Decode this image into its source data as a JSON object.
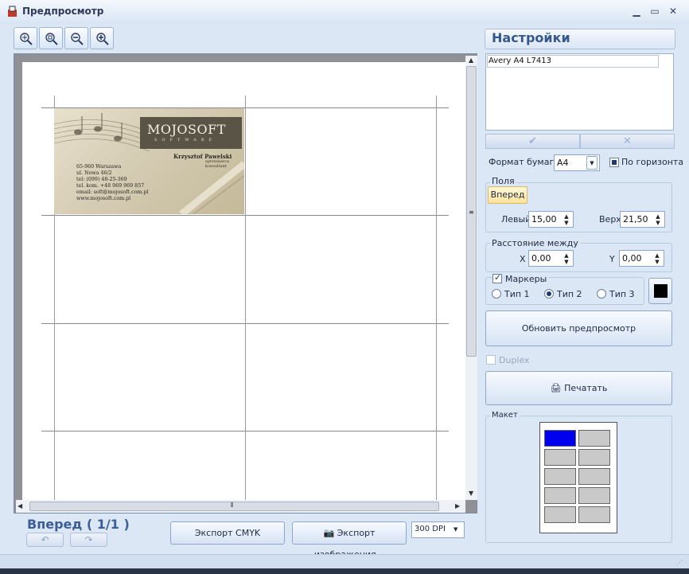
{
  "window": {
    "title": "Предпросмотр",
    "minimize": "▁",
    "maximize": "▭",
    "close": "✕"
  },
  "toolbar": {
    "icons": [
      "zoom-fit-icon",
      "zoom-actual-icon",
      "zoom-out-icon",
      "zoom-in-icon"
    ]
  },
  "preview": {
    "card": {
      "logo": "MOJOSOFT",
      "logo_sub": "SOFTWARE",
      "name": "Krzysztof Pawelski",
      "role": "sprzedawca konsultant",
      "lines": [
        "65-960 Warszawa",
        "ul. Nowa 46/2",
        "tel: (099) 48-25-369",
        "tel. kom. +48 969 969 857",
        "email: soft@mojosoft.com.pl",
        "www.mojosoft.com.pl"
      ]
    }
  },
  "bottom": {
    "page_nav": "Вперед ( 1/1 )",
    "prev": "↶",
    "next": "↷",
    "export_cmyk": "Экспорт CMYK",
    "export_image": "Экспорт изображения...",
    "dpi": "300 DPI"
  },
  "settings": {
    "title": "Настройки",
    "templates": [
      "Avery A4 L7413"
    ],
    "ok": "✔",
    "cancel": "✕",
    "paper_format_label": "Формат бумаги",
    "paper_format": "A4",
    "landscape_label": "По горизонтали",
    "landscape": true,
    "margins": {
      "title": "Поля",
      "tab": "Вперед",
      "left_label": "Левый",
      "left": "15,00",
      "top_label": "Верх",
      "top": "21,50"
    },
    "spacing": {
      "title": "Расстояние между",
      "x_label": "X",
      "x": "0,00",
      "y_label": "Y",
      "y": "0,00"
    },
    "markers": {
      "label": "Маркеры",
      "checked": true,
      "type1": "Тип 1",
      "type2": "Тип 2",
      "type3": "Тип 3",
      "selected": "Тип 2",
      "color": "#000000"
    },
    "refresh": "Обновить предпросмотр",
    "duplex": "Duplex",
    "print": "Печатать",
    "layout_title": "Макет"
  }
}
